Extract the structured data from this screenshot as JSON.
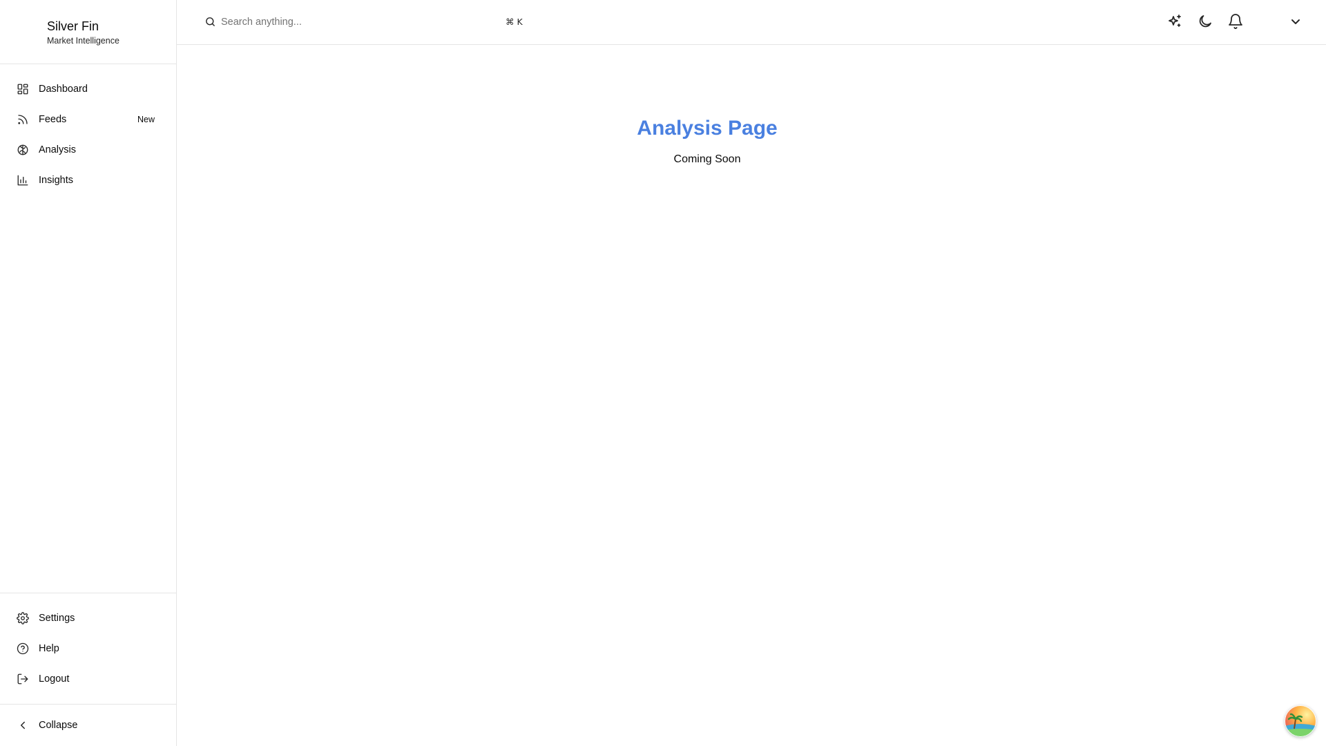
{
  "brand": {
    "name": "Silver Fin",
    "subtitle": "Market Intelligence"
  },
  "sidebar": {
    "nav": [
      {
        "label": "Dashboard",
        "icon": "dashboard-grid-icon"
      },
      {
        "label": "Feeds",
        "icon": "rss-icon",
        "badge": "New"
      },
      {
        "label": "Analysis",
        "icon": "brain-icon"
      },
      {
        "label": "Insights",
        "icon": "bar-chart-icon"
      }
    ],
    "footer": [
      {
        "label": "Settings",
        "icon": "gear-icon"
      },
      {
        "label": "Help",
        "icon": "help-circle-icon"
      },
      {
        "label": "Logout",
        "icon": "logout-icon"
      }
    ],
    "collapse": {
      "label": "Collapse",
      "icon": "chevron-left-icon"
    }
  },
  "topbar": {
    "search": {
      "placeholder": "Search anything...",
      "value": "",
      "shortcut": "⌘ K"
    },
    "actions": [
      {
        "name": "ai-sparkles-icon"
      },
      {
        "name": "moon-icon"
      },
      {
        "name": "bell-icon"
      },
      {
        "name": "chevron-down-icon"
      }
    ]
  },
  "main": {
    "title": "Analysis Page",
    "subtitle": "Coming Soon"
  },
  "colors": {
    "title_accent": "#4a80e0",
    "border": "#e5e5e5",
    "text": "#0a0a0a",
    "muted": "#737373"
  }
}
